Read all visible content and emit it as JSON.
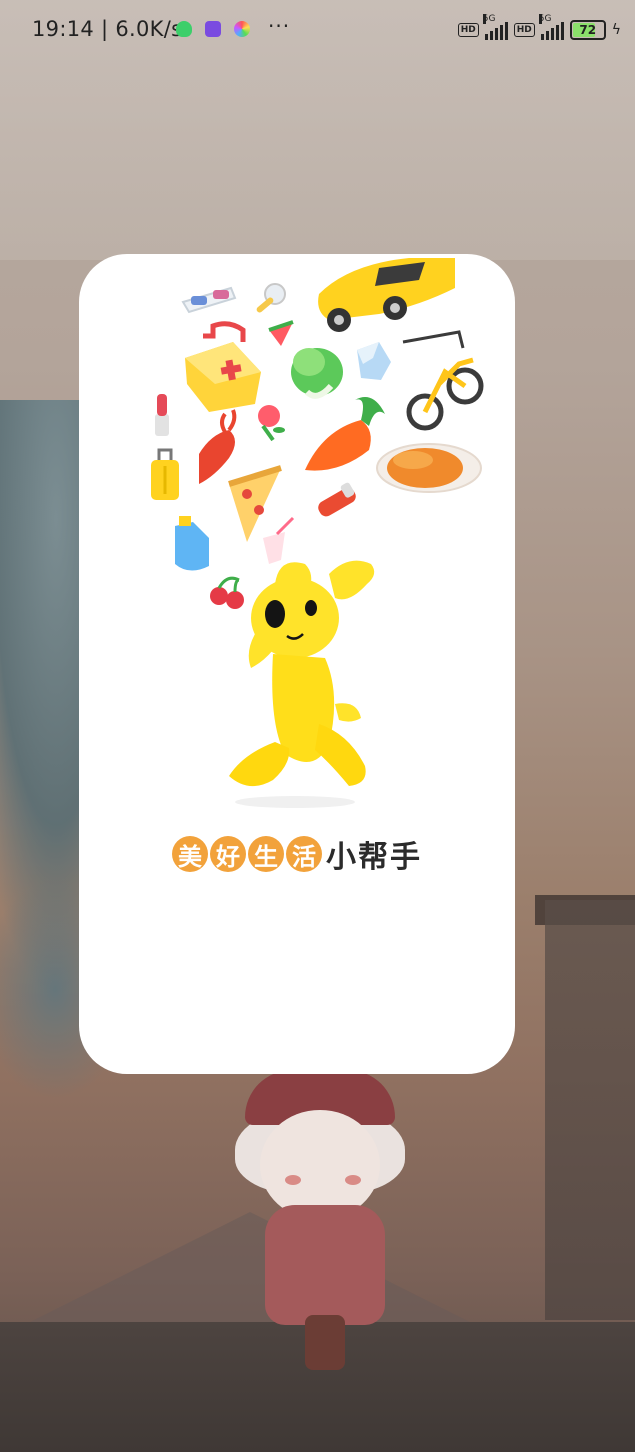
{
  "status_bar": {
    "time": "19:14",
    "net_speed": "| 6.0K/s",
    "more": "···",
    "hd1": "HD",
    "hd2": "HD",
    "net1": "5G",
    "net2": "5G",
    "battery": "72"
  },
  "splash": {
    "tagline_highlight": [
      "美",
      "好",
      "生",
      "活"
    ],
    "tagline_plain": "小帮手",
    "accent_color": "#f2a23b",
    "mascot_color": "#ffe32a"
  }
}
